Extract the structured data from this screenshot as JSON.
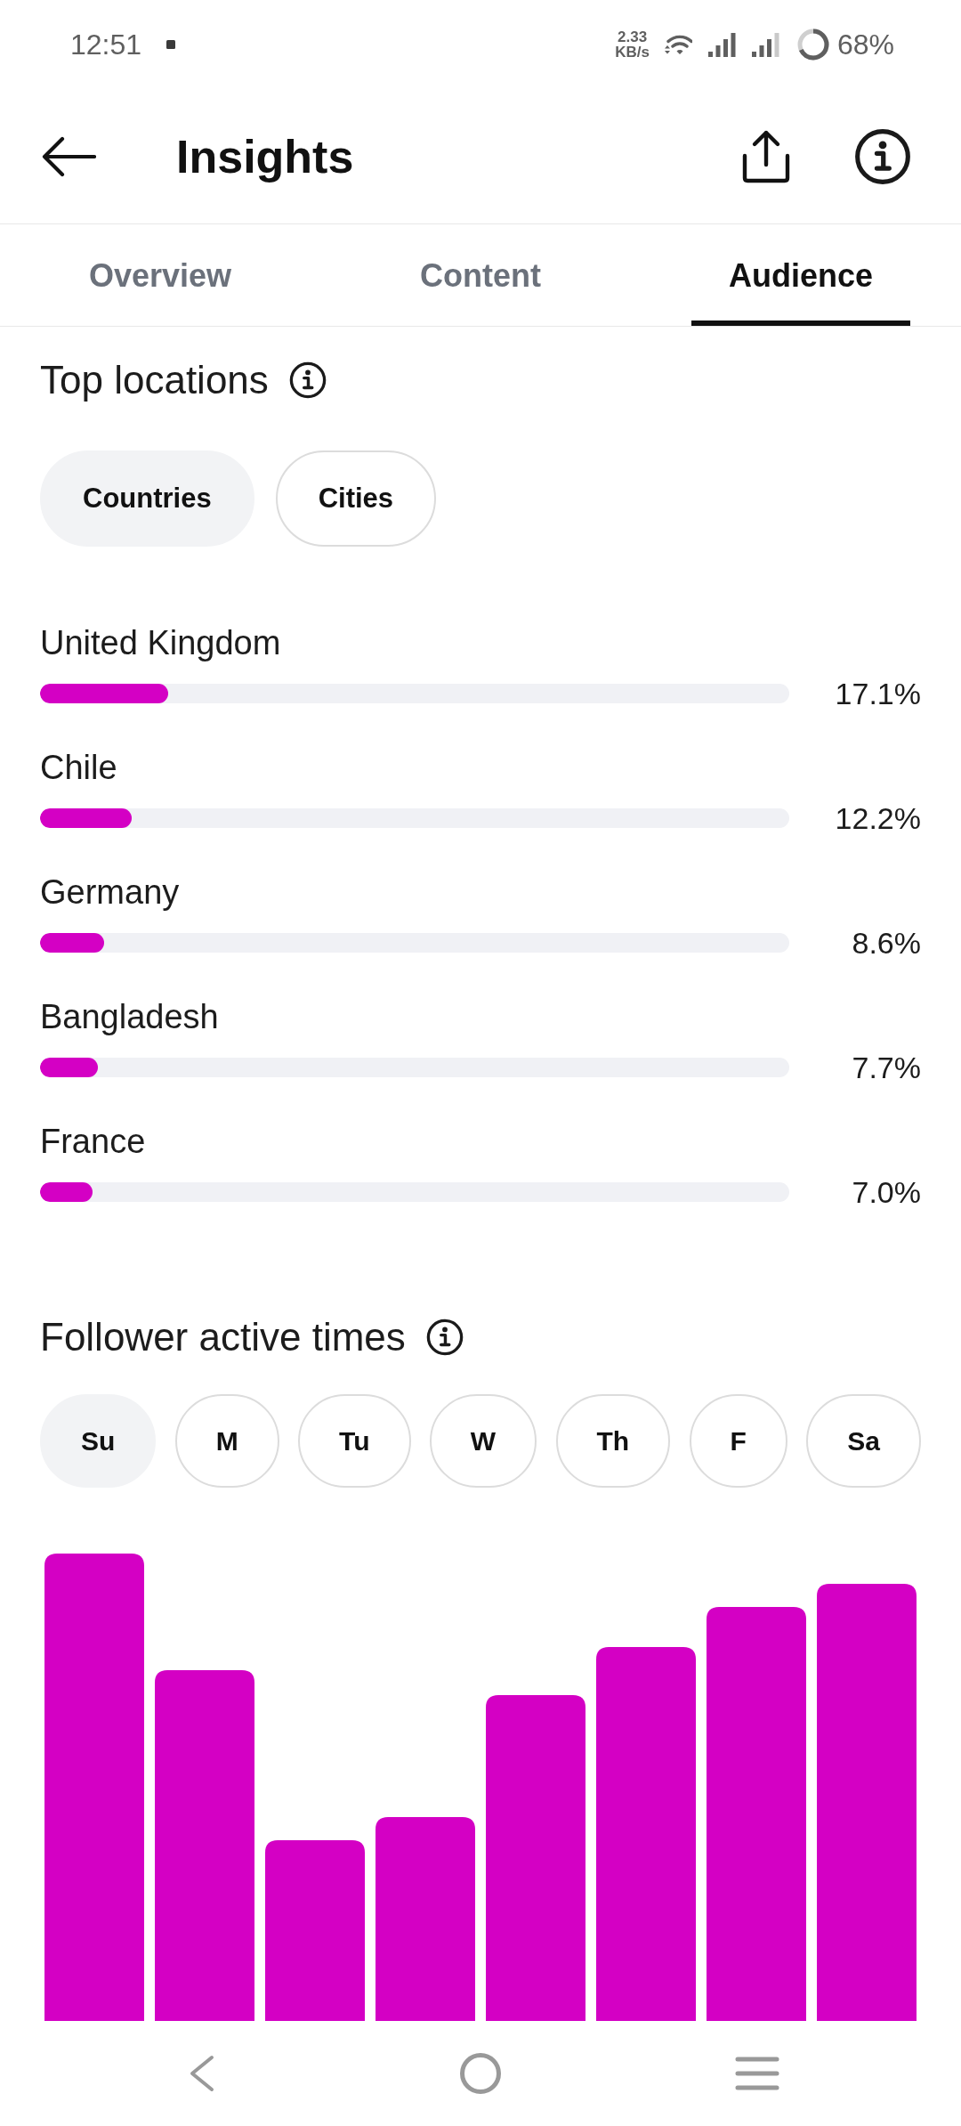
{
  "status_bar": {
    "time": "12:51",
    "network_speed": "2.33",
    "network_speed_unit": "KB/s",
    "battery": "68%"
  },
  "header": {
    "title": "Insights"
  },
  "tabs": [
    {
      "label": "Overview",
      "selected": false
    },
    {
      "label": "Content",
      "selected": false
    },
    {
      "label": "Audience",
      "selected": true
    }
  ],
  "top_locations": {
    "title": "Top locations",
    "filters": [
      {
        "label": "Countries",
        "selected": true
      },
      {
        "label": "Cities",
        "selected": false
      }
    ],
    "rows": [
      {
        "name": "United Kingdom",
        "level": 0.171,
        "reading": "17.1%"
      },
      {
        "name": "Chile",
        "level": 0.122,
        "reading": "12.2%"
      },
      {
        "name": "Germany",
        "level": 0.086,
        "reading": "8.6%"
      },
      {
        "name": "Bangladesh",
        "level": 0.077,
        "reading": "7.7%"
      },
      {
        "name": "France",
        "level": 0.07,
        "reading": "7.0%"
      }
    ]
  },
  "follower_active_times": {
    "title": "Follower active times",
    "days": [
      {
        "label": "Su",
        "selected": true
      },
      {
        "label": "M",
        "selected": false
      },
      {
        "label": "Tu",
        "selected": false
      },
      {
        "label": "W",
        "selected": false
      },
      {
        "label": "Th",
        "selected": false
      },
      {
        "label": "F",
        "selected": false
      },
      {
        "label": "Sa",
        "selected": false
      }
    ]
  }
}
